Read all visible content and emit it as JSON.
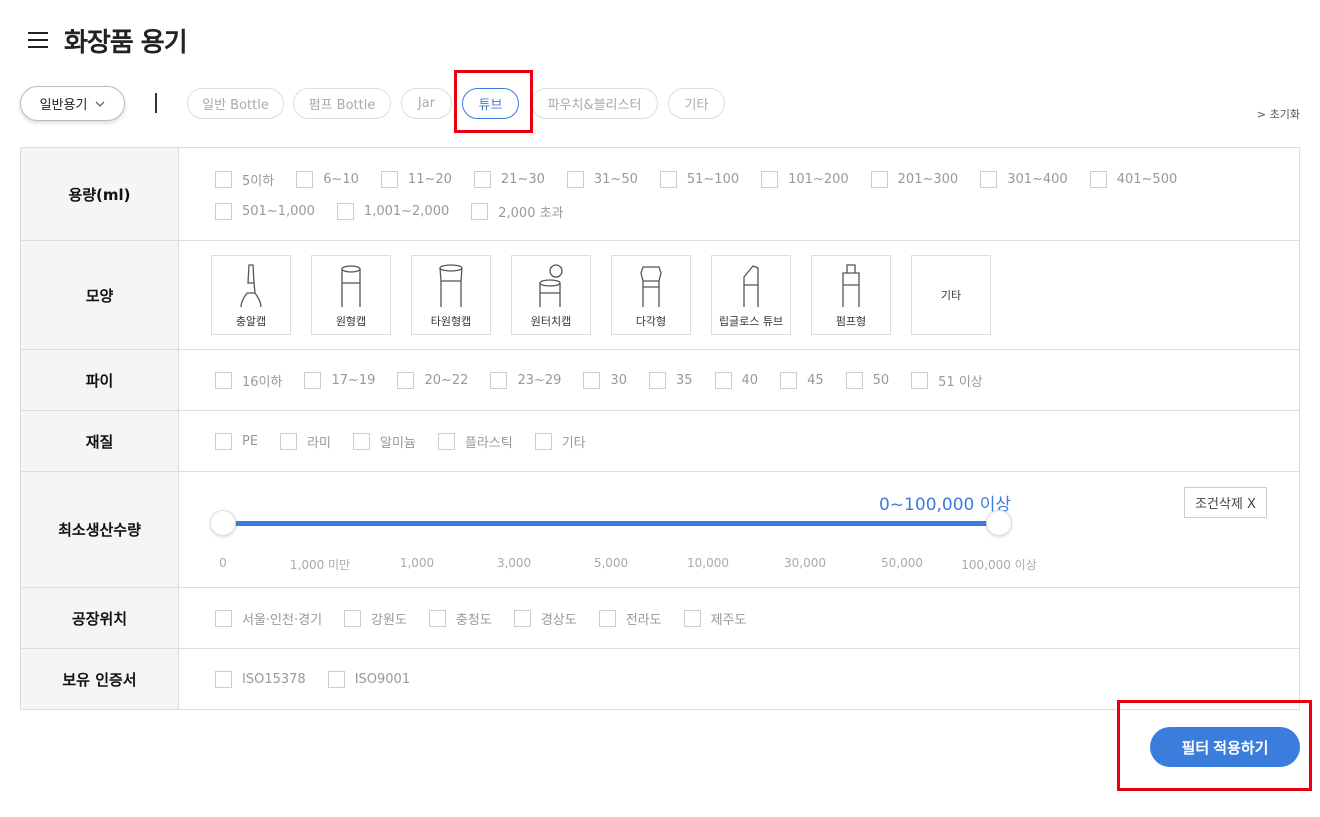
{
  "header": {
    "title": "화장품 용기"
  },
  "category_dropdown": {
    "selected": "일반용기"
  },
  "tabs": [
    {
      "label": "일반 Bottle",
      "active": false
    },
    {
      "label": "펌프 Bottle",
      "active": false
    },
    {
      "label": "Jar",
      "active": false
    },
    {
      "label": "튜브",
      "active": true
    },
    {
      "label": "파우치&블리스터",
      "active": false
    },
    {
      "label": "기타",
      "active": false
    }
  ],
  "reset_label": "> 초기화",
  "filters": {
    "capacity": {
      "label": "용량(ml)",
      "options": [
        "5이하",
        "6~10",
        "11~20",
        "21~30",
        "31~50",
        "51~100",
        "101~200",
        "201~300",
        "301~400",
        "401~500",
        "501~1,000",
        "1,001~2,000",
        "2,000 초과"
      ]
    },
    "shape": {
      "label": "모양",
      "options": [
        {
          "label": "충알캡",
          "icon": "bullet-cap-tube-icon"
        },
        {
          "label": "원형캡",
          "icon": "round-cap-tube-icon"
        },
        {
          "label": "타원형캡",
          "icon": "oval-cap-tube-icon"
        },
        {
          "label": "원터치캡",
          "icon": "one-touch-cap-tube-icon"
        },
        {
          "label": "다각형",
          "icon": "polygon-cap-tube-icon"
        },
        {
          "label": "립글로스 튜브",
          "icon": "lipgloss-tube-icon"
        },
        {
          "label": "펌프형",
          "icon": "pump-tube-icon"
        },
        {
          "label": "기타",
          "icon": ""
        }
      ]
    },
    "diameter": {
      "label": "파이",
      "options": [
        "16이하",
        "17~19",
        "20~22",
        "23~29",
        "30",
        "35",
        "40",
        "45",
        "50",
        "51 이상"
      ]
    },
    "material": {
      "label": "재질",
      "options": [
        "PE",
        "라미",
        "알미늄",
        "플라스틱",
        "기타"
      ]
    },
    "moq": {
      "label": "최소생산수량",
      "value_text": "0~100,000 이상",
      "clear_label": "조건삭제 X",
      "ticks": [
        "0",
        "1,000 미만",
        "1,000",
        "3,000",
        "5,000",
        "10,000",
        "30,000",
        "50,000",
        "100,000 이상"
      ],
      "range_index": [
        0,
        8
      ]
    },
    "factory": {
      "label": "공장위치",
      "options": [
        "서울·인천·경기",
        "강원도",
        "충청도",
        "경상도",
        "전라도",
        "제주도"
      ]
    },
    "certificate": {
      "label": "보유 인증서",
      "options": [
        "ISO15378",
        "ISO9001"
      ]
    }
  },
  "apply_button": {
    "label": "필터 적용하기"
  },
  "colors": {
    "accent": "#3b7ddd",
    "highlight": "#e60012"
  }
}
